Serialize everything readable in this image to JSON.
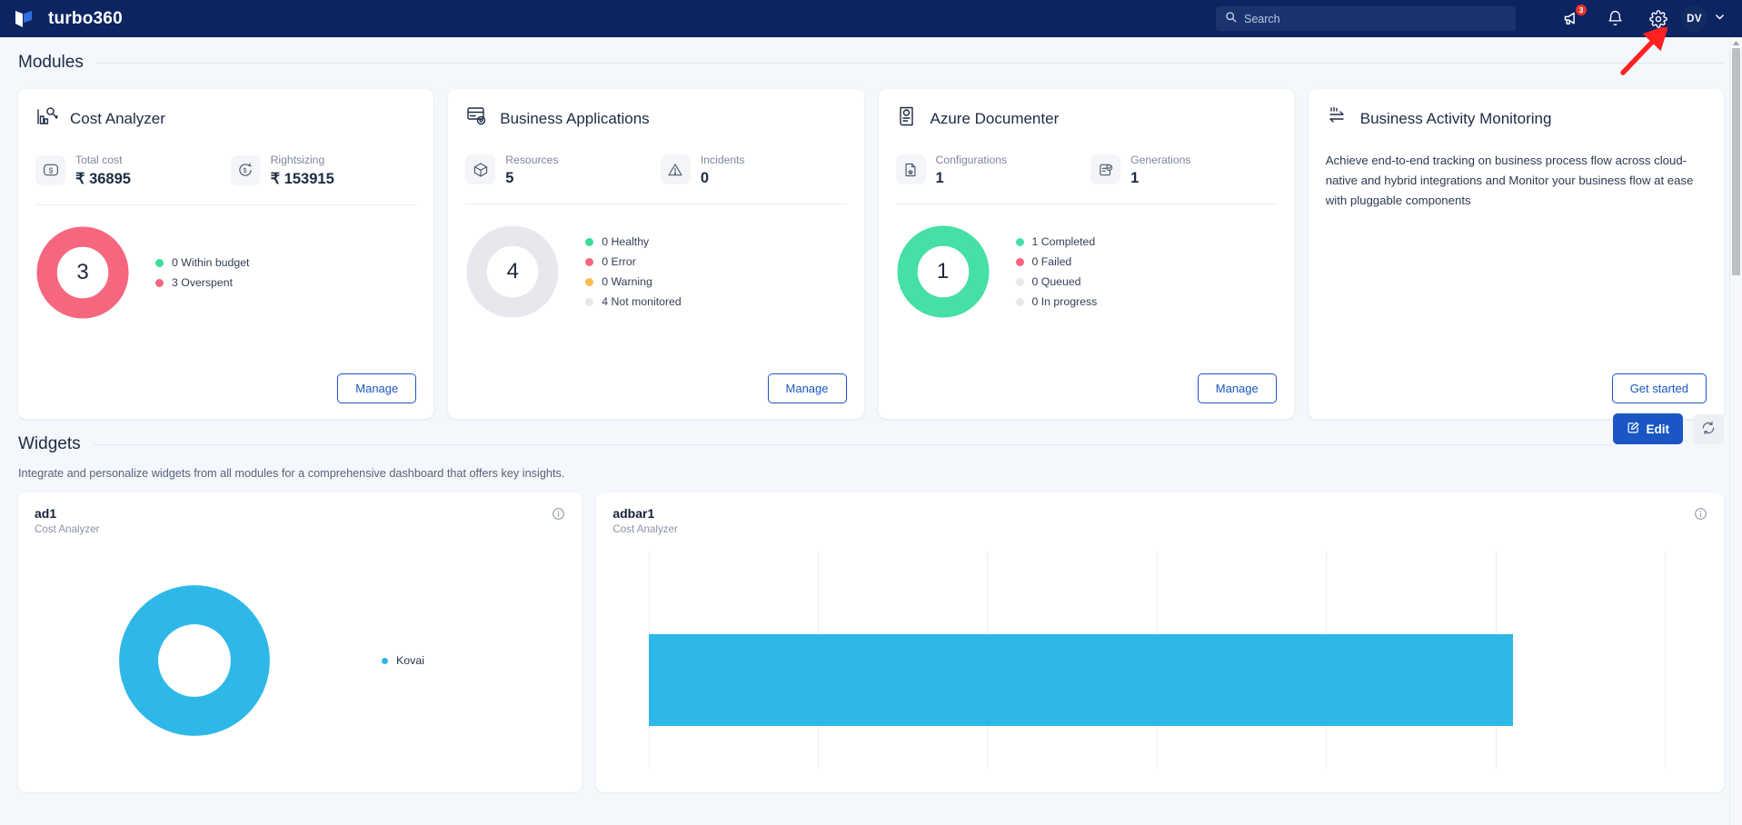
{
  "topnav": {
    "brand_name": "turbo360",
    "logo_icon": "turbo360-flag-logo",
    "search_placeholder": "Search",
    "search_value": "",
    "search_icon": "search-icon",
    "announcement_icon": "megaphone-icon",
    "announcement_badge": "3",
    "notification_icon": "bell-icon",
    "settings_icon": "gear-icon",
    "avatar_initials": "DV",
    "avatar_chevron_icon": "chevron-down-icon"
  },
  "modules_section": {
    "title": "Modules"
  },
  "modules": [
    {
      "title": "Cost Analyzer",
      "icon": "cost-analyzer-icon",
      "stats": [
        {
          "label": "Total cost",
          "value": "₹ 36895",
          "icon": "dollar-circle-icon"
        },
        {
          "label": "Rightsizing",
          "value": "₹ 153915",
          "icon": "dollar-refresh-icon"
        }
      ],
      "donut": {
        "center": "3",
        "segments": [
          {
            "label": "Within budget",
            "count": 0,
            "color": "#3ddc9a"
          },
          {
            "label": "Overspent",
            "count": 3,
            "color": "#f7667f"
          }
        ]
      },
      "legend": [
        {
          "text": "0 Within budget",
          "color": "#3ddc9a"
        },
        {
          "text": "3 Overspent",
          "color": "#f7667f"
        }
      ],
      "button": "Manage"
    },
    {
      "title": "Business Applications",
      "icon": "business-applications-icon",
      "stats": [
        {
          "label": "Resources",
          "value": "5",
          "icon": "cube-icon"
        },
        {
          "label": "Incidents",
          "value": "0",
          "icon": "warning-triangle-icon"
        }
      ],
      "donut": {
        "center": "4",
        "segments": [
          {
            "label": "Not monitored",
            "count": 4,
            "color": "#e6e8ed"
          }
        ]
      },
      "legend": [
        {
          "text": "0 Healthy",
          "color": "#3ddc9a"
        },
        {
          "text": "0 Error",
          "color": "#f7667f"
        },
        {
          "text": "0 Warning",
          "color": "#fbbd4e"
        },
        {
          "text": "4 Not monitored",
          "color": "#e6e8ed"
        }
      ],
      "button": "Manage"
    },
    {
      "title": "Azure Documenter",
      "icon": "azure-documenter-icon",
      "stats": [
        {
          "label": "Configurations",
          "value": "1",
          "icon": "document-star-icon"
        },
        {
          "label": "Generations",
          "value": "1",
          "icon": "document-check-icon"
        }
      ],
      "donut": {
        "center": "1",
        "segments": [
          {
            "label": "Completed",
            "count": 1,
            "color": "#46dfa6"
          }
        ]
      },
      "legend": [
        {
          "text": "1 Completed",
          "color": "#46dfa6"
        },
        {
          "text": "0 Failed",
          "color": "#f7667f"
        },
        {
          "text": "0 Queued",
          "color": "#e6e8ed"
        },
        {
          "text": "0 In progress",
          "color": "#e6e8ed"
        }
      ],
      "button": "Manage"
    },
    {
      "title": "Business Activity Monitoring",
      "icon": "business-activity-monitoring-icon",
      "description": "Achieve end-to-end tracking on business process flow across cloud-native and hybrid integrations and Monitor your business flow at ease with pluggable components",
      "button": "Get started"
    }
  ],
  "widgets_section": {
    "title": "Widgets",
    "subtitle": "Integrate and personalize widgets from all modules for a comprehensive dashboard that offers key insights.",
    "edit_label": "Edit",
    "edit_icon": "pencil-square-icon",
    "refresh_icon": "refresh-icon"
  },
  "widgets": [
    {
      "title": "ad1",
      "subtitle": "Cost Analyzer",
      "info_icon": "info-icon",
      "chart_ref": 0
    },
    {
      "title": "adbar1",
      "subtitle": "Cost Analyzer",
      "info_icon": "info-icon",
      "chart_ref": 1
    }
  ],
  "chart_data": [
    {
      "type": "pie",
      "title": "ad1",
      "subtitle": "Cost Analyzer",
      "labels": [
        "Kovai"
      ],
      "values": [
        100
      ],
      "colors": [
        "#2eb8e8"
      ],
      "legend": [
        "Kovai"
      ],
      "legend_position": "right",
      "donut": true
    },
    {
      "type": "bar",
      "title": "adbar1",
      "subtitle": "Cost Analyzer",
      "orientation": "horizontal",
      "categories": [
        ""
      ],
      "values": [
        85
      ],
      "colors": [
        "#2eb8e8"
      ],
      "grid": true,
      "gridline_count": 7,
      "xlim": [
        0,
        100
      ],
      "xlabel": "",
      "ylabel": ""
    }
  ],
  "scrollbar": {
    "icon": "scrollbar-thumb"
  },
  "annotation": {
    "icon": "red-arrow-annotation"
  }
}
